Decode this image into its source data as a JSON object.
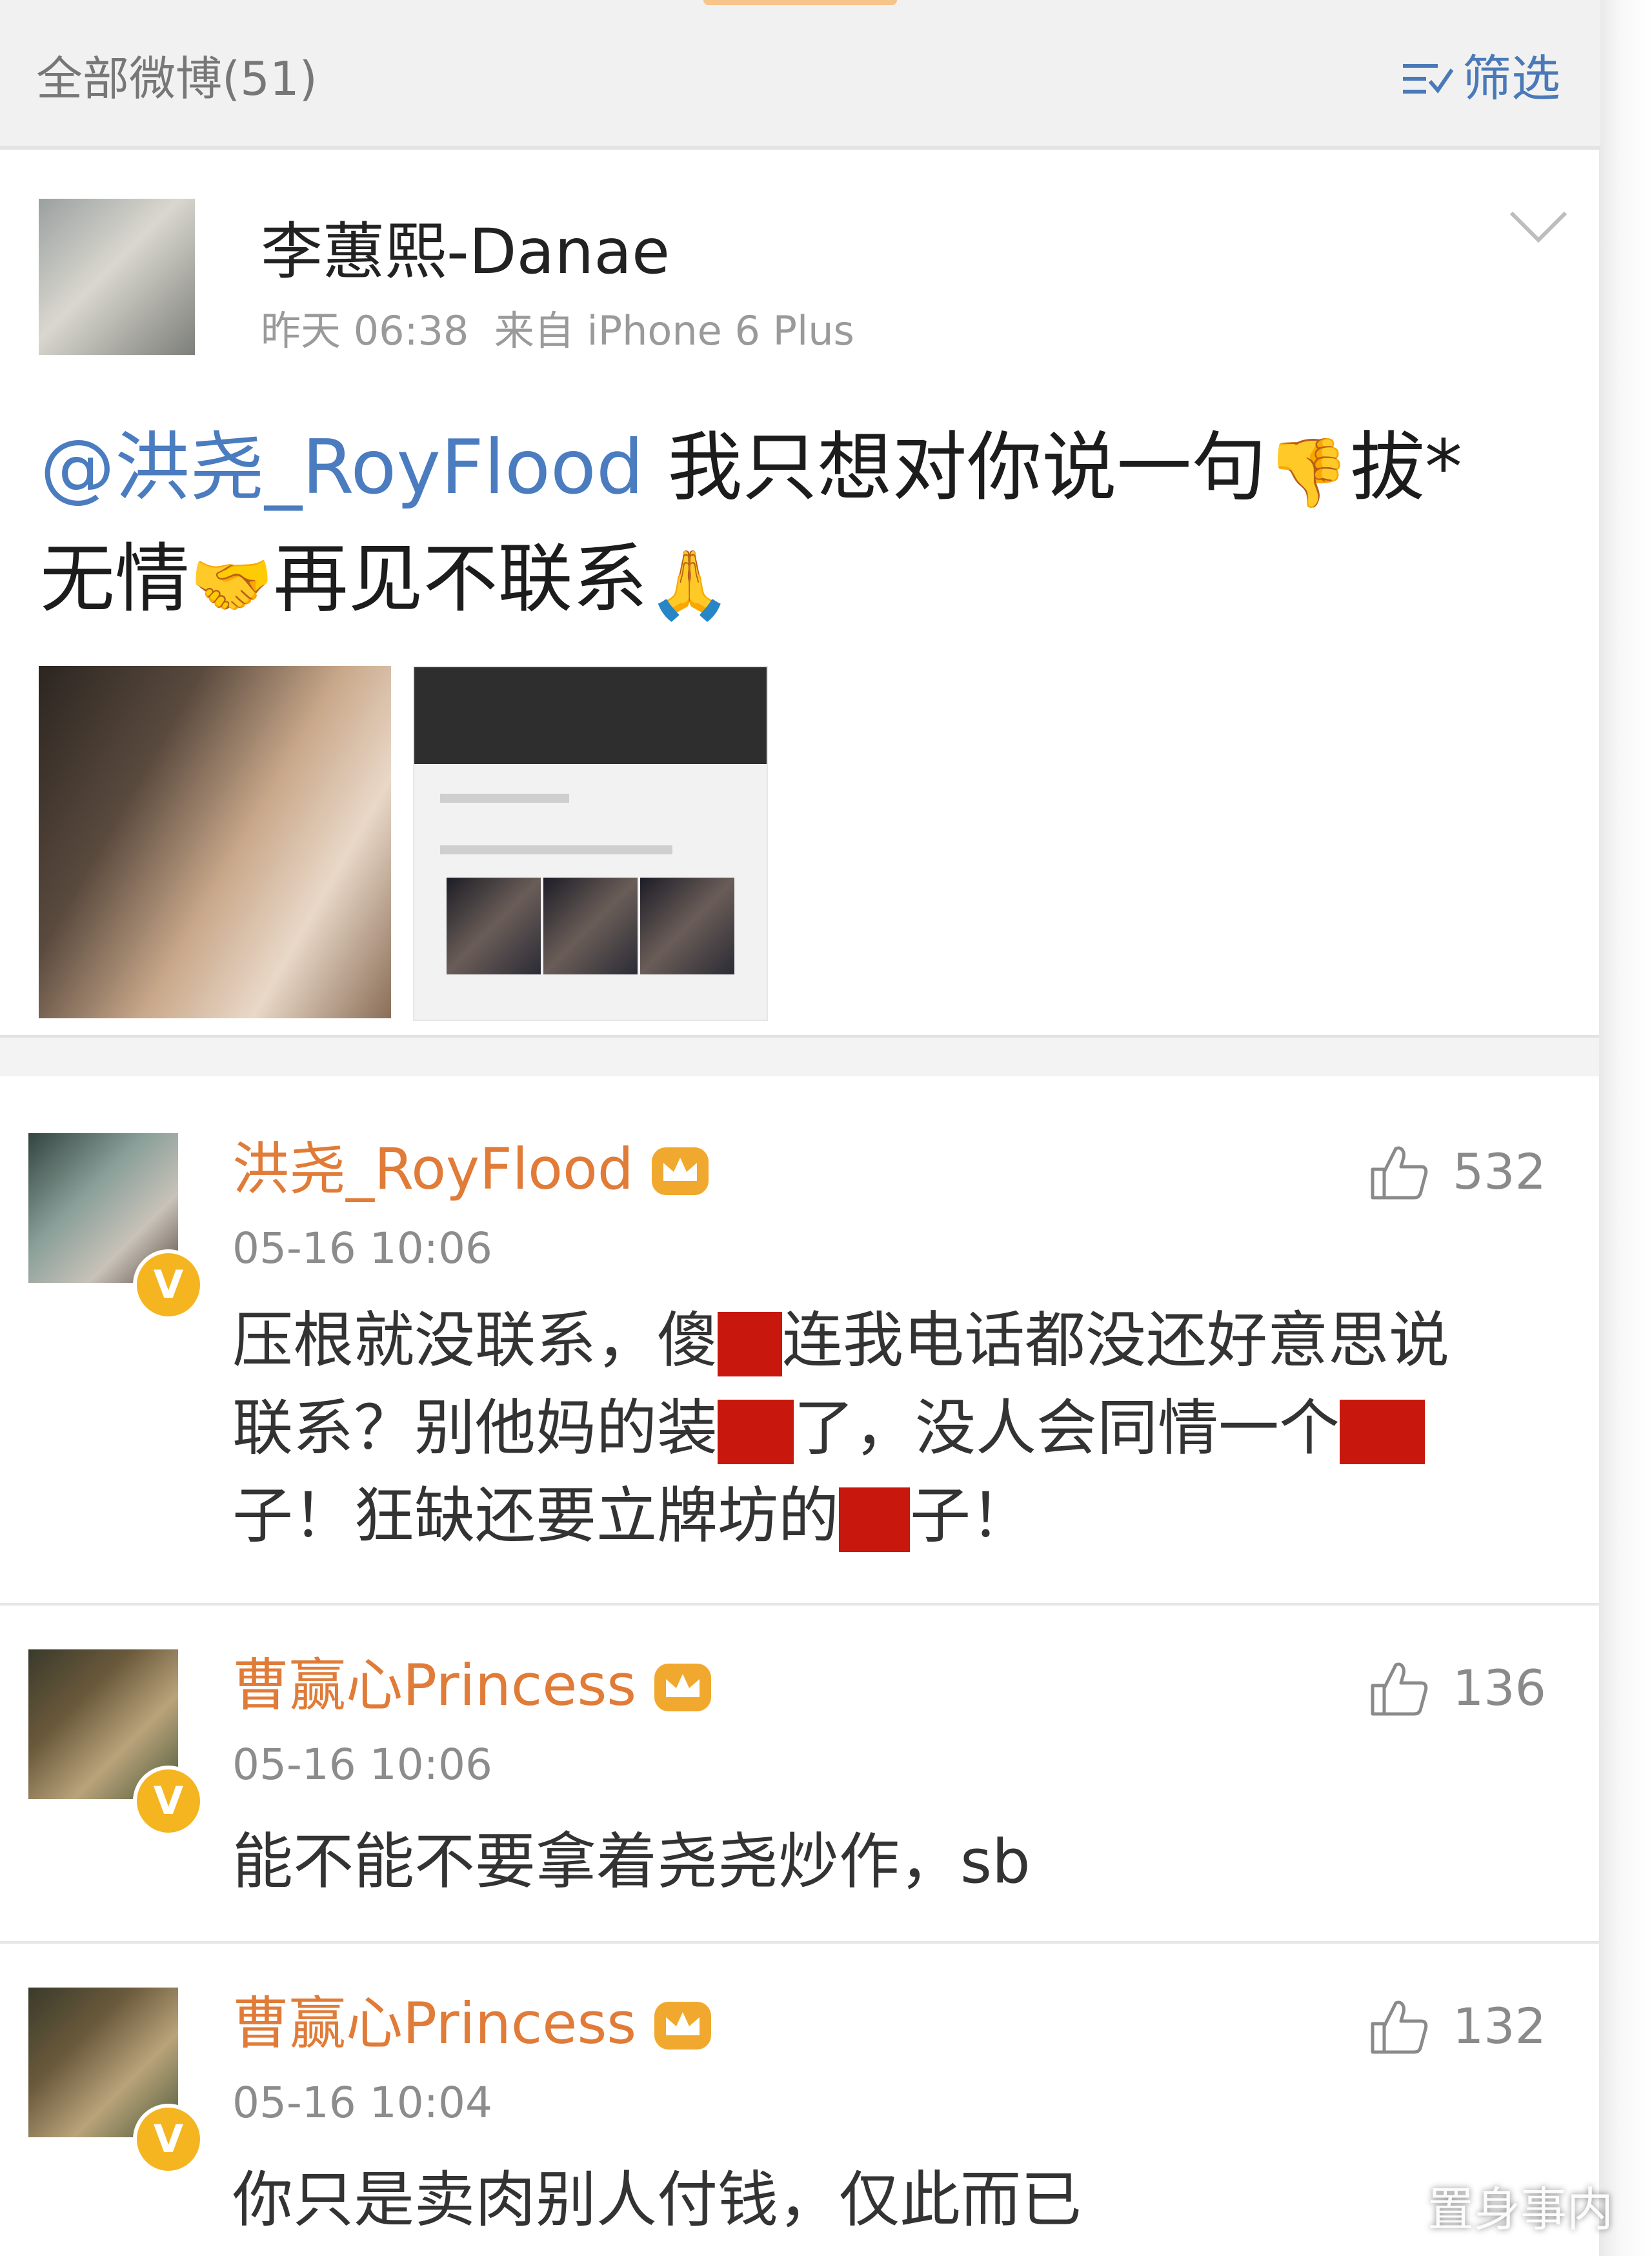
{
  "header": {
    "title": "全部微博(51)",
    "filter_label": "筛选"
  },
  "post": {
    "author": "李蕙熙-Danae",
    "meta": "昨天 06:38  来自 iPhone 6 Plus",
    "mention": "@洪尧_RoyFlood",
    "text_part1": " 我只想对你说一句",
    "emoji1": "👎",
    "text_part2": "拔*",
    "text_part3": "无情",
    "emoji2": "🤝",
    "text_part4": "再见不联系",
    "emoji3": "🙏"
  },
  "comments": [
    {
      "name": "洪尧_RoyFlood",
      "time": "05-16 10:06",
      "likes": "532",
      "text_a": "压根就没联系，傻",
      "text_b": "连我电话都没还好意思说",
      "text_c": "联系？别他妈的装",
      "text_d": "了，没人会同情一个",
      "text_e": "子！狂缺还要立牌坊的",
      "text_f": "子！"
    },
    {
      "name": "曹赢心Princess",
      "time": "05-16 10:06",
      "likes": "136",
      "text": "能不能不要拿着尧尧炒作，sb"
    },
    {
      "name": "曹赢心Princess",
      "time": "05-16 10:04",
      "likes": "132",
      "text": "你只是卖肉别人付钱，仅此而已"
    }
  ],
  "badge_letter": "V",
  "watermark": "置身事内",
  "colors": {
    "mention": "#4a7cbf",
    "commenter_name": "#e07b38",
    "vip_badge": "#f5b521",
    "redaction": "#c8170d"
  }
}
